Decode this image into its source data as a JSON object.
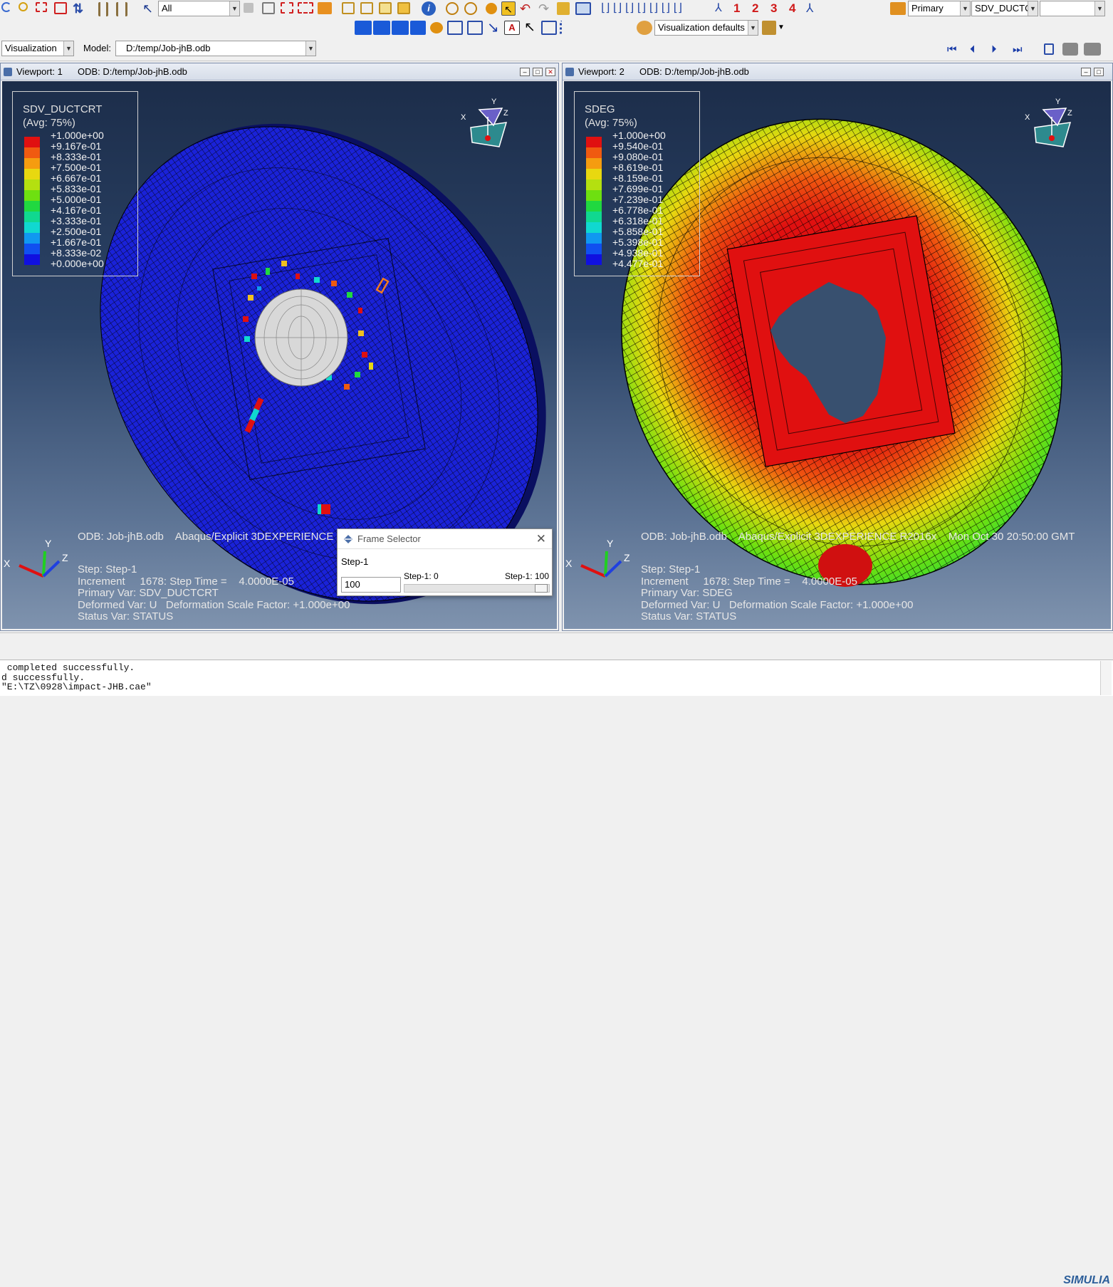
{
  "toolbar": {
    "selection_filter": "All",
    "numbers": [
      "1",
      "2",
      "3",
      "4"
    ],
    "primary_label": "Primary",
    "variable_combo": "SDV_DUCTCR",
    "viz_defaults": "Visualization defaults"
  },
  "context": {
    "module": "Visualization",
    "model_label": "Model:",
    "model_path": "D:/temp/Job-jhB.odb"
  },
  "viewport1": {
    "title": "Viewport: 1",
    "odb": "ODB: D:/temp/Job-jhB.odb",
    "legend_title": "SDV_DUCTCRT",
    "legend_avg": "(Avg: 75%)",
    "legend_values": [
      "+1.000e+00",
      "+9.167e-01",
      "+8.333e-01",
      "+7.500e-01",
      "+6.667e-01",
      "+5.833e-01",
      "+5.000e-01",
      "+4.167e-01",
      "+3.333e-01",
      "+2.500e-01",
      "+1.667e-01",
      "+8.333e-02",
      "+0.000e+00"
    ],
    "info_line1": "ODB: Job-jhB.odb    Abaqus/Explicit 3DEXPERIENCE R2016x",
    "info_line2": "Step: Step-1",
    "info_line3": "Increment     1678: Step Time =    4.0000E-05",
    "info_line4": "Primary Var: SDV_DUCTCRT",
    "info_line5": "Deformed Var: U   Deformation Scale Factor: +1.000e+00",
    "info_line6": "Status Var: STATUS"
  },
  "viewport2": {
    "title": "Viewport: 2",
    "odb": "ODB: D:/temp/Job-jhB.odb",
    "legend_title": "SDEG",
    "legend_avg": "(Avg: 75%)",
    "legend_values": [
      "+1.000e+00",
      "+9.540e-01",
      "+9.080e-01",
      "+8.619e-01",
      "+8.159e-01",
      "+7.699e-01",
      "+7.239e-01",
      "+6.778e-01",
      "+6.318e-01",
      "+5.858e-01",
      "+5.398e-01",
      "+4.938e-01",
      "+4.477e-01"
    ],
    "info_line1": "ODB: Job-jhB.odb    Abaqus/Explicit 3DEXPERIENCE R2016x    Mon Oct 30 20:50:00 GMT",
    "info_line2": "Step: Step-1",
    "info_line3": "Increment     1678: Step Time =    4.0000E-05",
    "info_line4": "Primary Var: SDEG",
    "info_line5": "Deformed Var: U   Deformation Scale Factor: +1.000e+00",
    "info_line6": "Status Var: STATUS"
  },
  "legend_colors": [
    "#e01010",
    "#f05a10",
    "#f59c10",
    "#e8d810",
    "#b4e010",
    "#6ee010",
    "#20d840",
    "#10d890",
    "#10d8d0",
    "#1098f0",
    "#1050f0",
    "#1010e0"
  ],
  "frame_selector": {
    "title": "Frame Selector",
    "step": "Step-1",
    "value": "100",
    "min_label": "Step-1: 0",
    "max_label": "Step-1: 100",
    "position": 1.0
  },
  "messages": {
    "line1": " completed successfully.",
    "line2": "d successfully.",
    "line3": "\"E:\\TZ\\0928\\impact-JHB.cae\""
  },
  "brand": "SIMULIA"
}
